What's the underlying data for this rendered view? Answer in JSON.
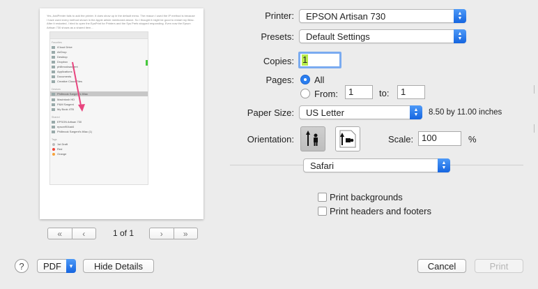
{
  "preview": {
    "paragraph": "Yes, AddPrinter fails to add the printer. It does show up in the default menu. The reason I used the IP method is because I have used every method shown in the Apple article mentioned above. So I thought it might be good to restart my iMac. After it restarted, I tried to open the EpsPrint for Printers and the Sys Prefs stopped responding. Even now the Epson Artisan 730 shows as a shared item...",
    "sidebar": {
      "favorites_label": "Favorites",
      "favorites": [
        "iCloud Drive",
        "AirDrop",
        "Desktop",
        "Dropbox",
        "philbrooksargent",
        "Applications",
        "Documents",
        "Creative Cloud Files"
      ],
      "devices_label": "Devices",
      "devices": [
        "Philbrook Sargent's iMac",
        "Macintosh HD",
        "P&M Sargent",
        "My Book 4TB"
      ],
      "shared_label": "Shared",
      "shared": [
        "EPSON Artisan 730",
        "epson904ad4",
        "Philbrook Sargent's iMac (1)"
      ],
      "tags_label": "Tags",
      "tags": [
        {
          "name": "1st Draft",
          "color": "#bbbbbb"
        },
        {
          "name": "Red",
          "color": "#f0453c"
        },
        {
          "name": "Orange",
          "color": "#f6a23a"
        }
      ]
    }
  },
  "pager": {
    "first_icon": "first-page-icon",
    "prev_icon": "prev-page-icon",
    "next_icon": "next-page-icon",
    "last_icon": "last-page-icon",
    "label": "1 of 1"
  },
  "form": {
    "printer_label": "Printer:",
    "printer_value": "EPSON Artisan 730",
    "presets_label": "Presets:",
    "presets_value": "Default Settings",
    "copies_label": "Copies:",
    "copies_value": "1",
    "pages_label": "Pages:",
    "pages_all": "All",
    "pages_from": "From:",
    "from_value": "1",
    "to_label": "to:",
    "to_value": "1",
    "paper_label": "Paper Size:",
    "paper_value": "US Letter",
    "paper_dims": "8.50 by 11.00 inches",
    "orientation_label": "Orientation:",
    "scale_label": "Scale:",
    "scale_value": "100",
    "scale_unit": "%",
    "app_menu_value": "Safari",
    "print_backgrounds": "Print backgrounds",
    "print_headers": "Print headers and footers"
  },
  "footer": {
    "help": "?",
    "pdf": "PDF",
    "hide_details": "Hide Details",
    "cancel": "Cancel",
    "print": "Print"
  },
  "colors": {
    "accent": "#2a7ef0",
    "selection_highlight": "#b9ec4b",
    "arrow": "#e8457f"
  }
}
